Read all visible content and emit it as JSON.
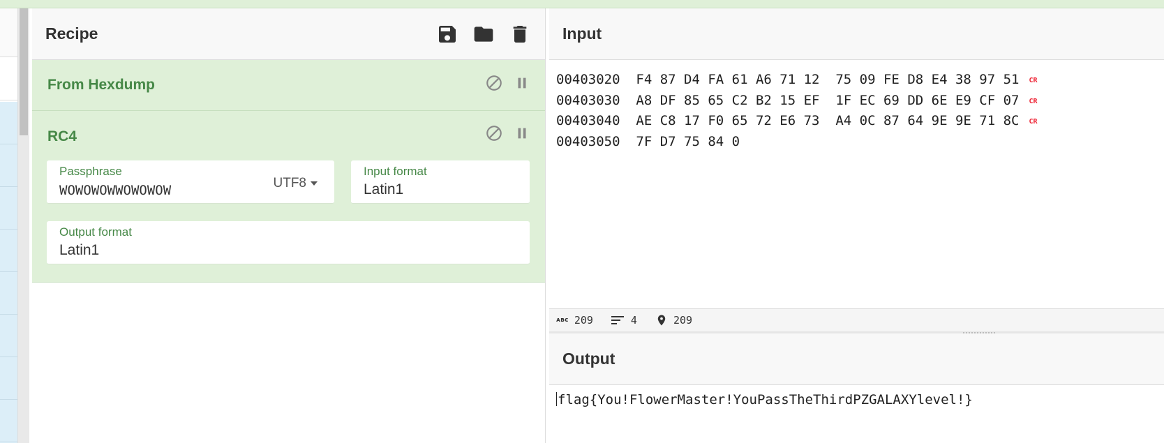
{
  "recipe": {
    "title": "Recipe",
    "operations": [
      {
        "name": "From Hexdump"
      },
      {
        "name": "RC4",
        "passphrase": {
          "label": "Passphrase",
          "value": "WOWOWOWWOWOWOW",
          "encoding": "UTF8"
        },
        "input_format": {
          "label": "Input format",
          "value": "Latin1"
        },
        "output_format": {
          "label": "Output format",
          "value": "Latin1"
        }
      }
    ]
  },
  "input": {
    "title": "Input",
    "lines": [
      {
        "text": "00403020  F4 87 D4 FA 61 A6 71 12  75 09 FE D8 E4 38 97 51",
        "eol": "CR"
      },
      {
        "text": "00403030  A8 DF 85 65 C2 B2 15 EF  1F EC 69 DD 6E E9 CF 07",
        "eol": "CR"
      },
      {
        "text": "00403040  AE C8 17 F0 65 72 E6 73  A4 0C 87 64 9E 9E 71 8C",
        "eol": "CR"
      },
      {
        "text": "00403050  7F D7 75 84 0",
        "eol": ""
      }
    ],
    "stats": {
      "length": "209",
      "lines": "4",
      "position": "209"
    }
  },
  "output": {
    "title": "Output",
    "text": "flag{You!FlowerMaster!YouPassTheThirdPZGALAXYlevel!}"
  },
  "colors": {
    "op_bg": "#dff0d8",
    "op_text": "#468847",
    "cr_marker": "#e22233",
    "ops_list_bg": "#dceef8"
  }
}
